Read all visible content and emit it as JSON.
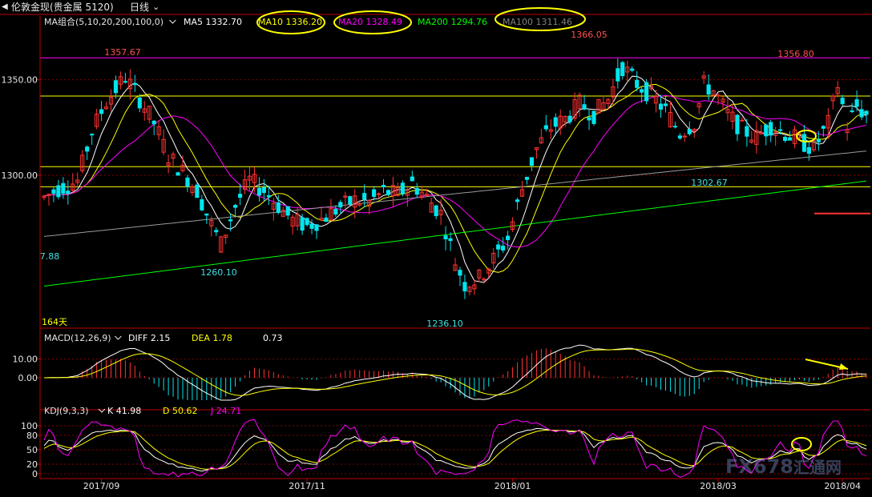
{
  "title_bar": {
    "prev_icon": "triangle-left-icon",
    "instrument": "伦敦金现(贵金属 5120)",
    "period": "日线",
    "dropdown_icon": "chevron-down-icon"
  },
  "legends": {
    "price": {
      "label": "MA组合(5,10,20,200,100,0)",
      "items": [
        {
          "name": "MA5",
          "value": "1332.70",
          "color": "#ffffff"
        },
        {
          "name": "MA10",
          "value": "1336.20",
          "color": "#ffff00"
        },
        {
          "name": "MA20",
          "value": "1328.49",
          "color": "#ff00ff"
        },
        {
          "name": "MA200",
          "value": "1294.76",
          "color": "#00ff00"
        },
        {
          "name": "MA100",
          "value": "1311.46",
          "color": "#808080"
        }
      ]
    },
    "macd": {
      "label": "MACD(12,26,9)",
      "items": [
        {
          "name": "DIFF",
          "value": "2.15",
          "color": "#ffffff"
        },
        {
          "name": "DEA",
          "value": "1.78",
          "color": "#ffff00"
        },
        {
          "name": "",
          "value": "0.73",
          "color": "#ffffff"
        }
      ]
    },
    "kdj": {
      "label": "KDJ(9,3,3)",
      "items": [
        {
          "name": "K",
          "value": "41.98",
          "color": "#ffffff"
        },
        {
          "name": "D",
          "value": "50.62",
          "color": "#ffff00"
        },
        {
          "name": "J",
          "value": "24.71",
          "color": "#ff00ff"
        }
      ]
    }
  },
  "price_annotations": [
    {
      "text": "1357.67",
      "color": "#ff5050"
    },
    {
      "text": "1366.05",
      "color": "#ff5050"
    },
    {
      "text": "1356.80",
      "color": "#ff5050"
    },
    {
      "text": "1260.10",
      "color": "#40e0e0"
    },
    {
      "text": "1236.10",
      "color": "#40e0e0"
    },
    {
      "text": "1302.67",
      "color": "#40e0e0"
    },
    {
      "text": "7.88",
      "color": "#40e0e0"
    },
    {
      "text": "164天",
      "color": "#ffff00"
    }
  ],
  "watermark": {
    "text": "FX678",
    "sub": "汇通网"
  },
  "colors": {
    "up": "#ff3232",
    "down": "#00e5ee",
    "grid": "#8b0000",
    "axis": "#c00000"
  },
  "chart_data": {
    "type": "candlestick",
    "panels": [
      {
        "name": "price",
        "y_axis_ticks": [
          "1350.00",
          "1300.00"
        ],
        "y_axis_values": [
          1350,
          1300
        ],
        "ylim": [
          1220,
          1375
        ],
        "horizontal_levels": [
          1361.5,
          1341.5,
          1304.5,
          1294,
          1280
        ],
        "level_colors": [
          "#ff00ff",
          "#ffff00",
          "#ffff00",
          "#ffff00",
          "#ff3232"
        ]
      },
      {
        "name": "macd",
        "y_axis_ticks": [
          "10.00",
          "0.00"
        ],
        "y_axis_values": [
          10,
          0
        ],
        "ylim": [
          -12,
          18
        ]
      },
      {
        "name": "kdj",
        "y_axis_ticks": [
          "100",
          "80",
          "50",
          "20",
          "0"
        ],
        "y_axis_values": [
          100,
          80,
          50,
          20,
          0
        ],
        "ylim": [
          -10,
          120
        ]
      }
    ],
    "x_axis_ticks": [
      {
        "label": "2017/09",
        "index": 12
      },
      {
        "label": "2017/11",
        "index": 55
      },
      {
        "label": "2018/01",
        "index": 98
      },
      {
        "label": "2018/03",
        "index": 141
      },
      {
        "label": "2018/04",
        "index": 167
      }
    ],
    "anchors": [
      [
        0,
        1285,
        1292
      ],
      [
        3,
        1290,
        1296
      ],
      [
        7,
        1294,
        1300
      ],
      [
        10,
        1320,
        1326
      ],
      [
        13,
        1335,
        1342
      ],
      [
        17,
        1348,
        1355
      ],
      [
        20,
        1338,
        1342
      ],
      [
        23,
        1325,
        1330
      ],
      [
        26,
        1308,
        1312
      ],
      [
        29,
        1300,
        1304
      ],
      [
        32,
        1290,
        1294
      ],
      [
        35,
        1272,
        1276
      ],
      [
        37,
        1262,
        1266
      ],
      [
        40,
        1282,
        1286
      ],
      [
        43,
        1295,
        1300
      ],
      [
        46,
        1290,
        1294
      ],
      [
        49,
        1282,
        1286
      ],
      [
        52,
        1275,
        1278
      ],
      [
        55,
        1272,
        1275
      ],
      [
        58,
        1276,
        1278
      ],
      [
        62,
        1282,
        1285
      ],
      [
        65,
        1286,
        1288
      ],
      [
        68,
        1285,
        1287
      ],
      [
        71,
        1290,
        1293
      ],
      [
        74,
        1288,
        1292
      ],
      [
        77,
        1295,
        1297
      ],
      [
        80,
        1287,
        1290
      ],
      [
        83,
        1278,
        1282
      ],
      [
        86,
        1252,
        1258
      ],
      [
        88,
        1240,
        1246
      ],
      [
        91,
        1244,
        1248
      ],
      [
        94,
        1254,
        1258
      ],
      [
        97,
        1265,
        1269
      ],
      [
        100,
        1290,
        1296
      ],
      [
        103,
        1310,
        1318
      ],
      [
        106,
        1322,
        1328
      ],
      [
        109,
        1327,
        1332
      ],
      [
        112,
        1335,
        1340
      ],
      [
        115,
        1330,
        1334
      ],
      [
        118,
        1338,
        1342
      ],
      [
        121,
        1354,
        1360
      ],
      [
        124,
        1346,
        1350
      ],
      [
        127,
        1340,
        1344
      ],
      [
        130,
        1332,
        1336
      ],
      [
        133,
        1320,
        1324
      ],
      [
        136,
        1325,
        1330
      ],
      [
        138,
        1345,
        1350
      ],
      [
        140,
        1342,
        1347
      ],
      [
        143,
        1330,
        1334
      ],
      [
        146,
        1322,
        1326
      ],
      [
        149,
        1318,
        1322
      ],
      [
        152,
        1324,
        1328
      ],
      [
        155,
        1320,
        1324
      ],
      [
        158,
        1316,
        1320
      ],
      [
        161,
        1312,
        1316
      ],
      [
        164,
        1324,
        1330
      ],
      [
        166,
        1345,
        1350
      ],
      [
        168,
        1324,
        1328
      ],
      [
        170,
        1334,
        1338
      ],
      [
        172,
        1330,
        1333
      ]
    ]
  }
}
